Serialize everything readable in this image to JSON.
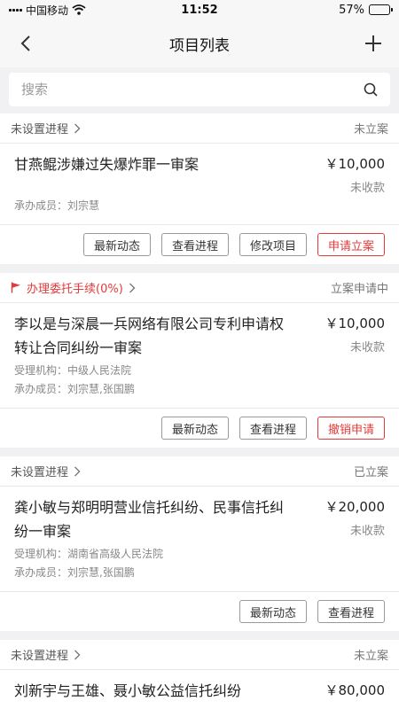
{
  "status_bar": {
    "carrier": "中国移动",
    "time": "11:52",
    "battery": "57%",
    "battery_level": 0.57
  },
  "nav": {
    "title": "项目列表",
    "back_icon": "back-arrow-icon",
    "add_icon": "plus-icon"
  },
  "search": {
    "placeholder": "搜索"
  },
  "labels": {
    "agency": "受理机构：",
    "members": "承办成员："
  },
  "actions": {
    "latest": "最新动态",
    "progress": "查看进程",
    "edit": "修改项目",
    "apply": "申请立案",
    "cancel": "撤销申请"
  },
  "projects": [
    {
      "progress": "未设置进程",
      "status": "未立案",
      "title": "甘燕鲲涉嫌过失爆炸罪一审案",
      "amount": "￥10,000",
      "fee_status": "未收款",
      "members": "刘宗慧"
    },
    {
      "progress": "办理委托手续(0%)",
      "status": "立案申请中",
      "title": "李以是与深晨一兵网络有限公司专利申请权转让合同纠纷一审案",
      "amount": "￥10,000",
      "fee_status": "未收款",
      "agency": "中级人民法院",
      "members": "刘宗慧,张国鹏"
    },
    {
      "progress": "未设置进程",
      "status": "已立案",
      "title": "龚小敏与郑明明营业信托纠纷、民事信托纠纷一审案",
      "amount": "￥20,000",
      "fee_status": "未收款",
      "agency": "湖南省高级人民法院",
      "members": "刘宗慧,张国鹏"
    },
    {
      "progress": "未设置进程",
      "status": "未立案",
      "title": "刘新宇与王雄、聂小敏公益信托纠纷",
      "amount": "￥80,000"
    }
  ],
  "colors": {
    "accent": "#e33b3b",
    "background": "#f1f1f3"
  }
}
